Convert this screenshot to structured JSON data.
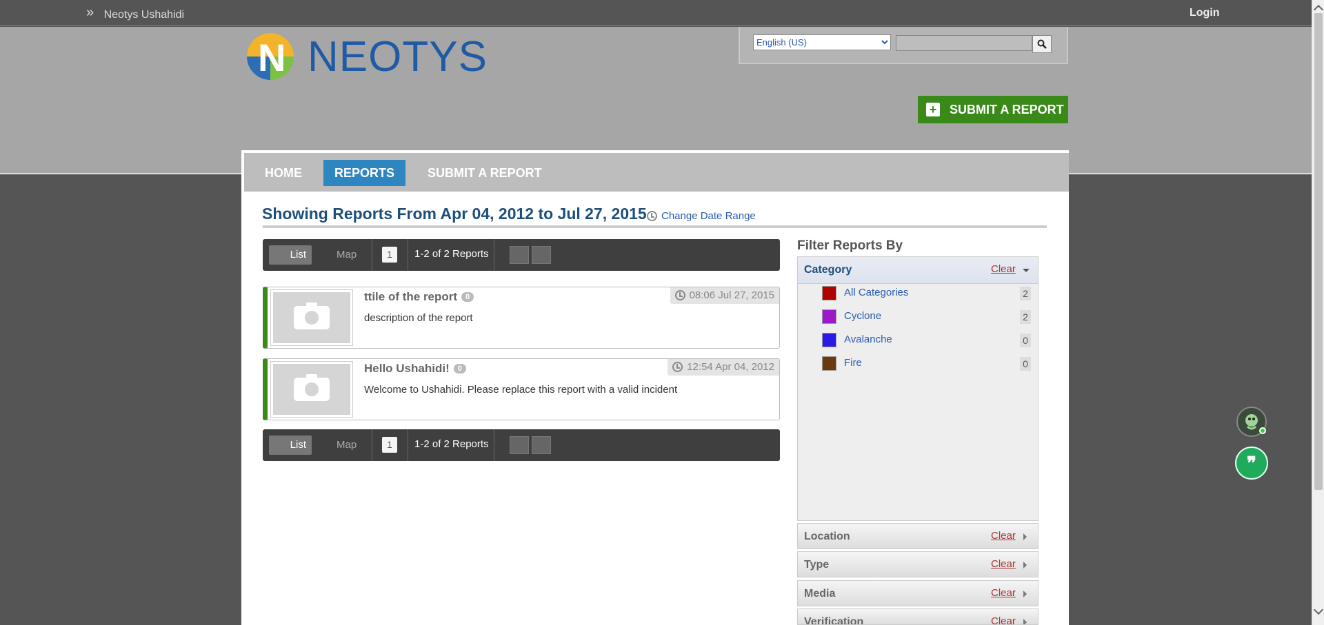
{
  "topbar": {
    "breadcrumb": "Neotys Ushahidi",
    "login_label": "Login"
  },
  "header": {
    "logo_text": "NEOTYS",
    "language_selected": "English (US)",
    "language_options": [
      "English (US)"
    ],
    "search_value": "",
    "submit_report_label": "SUBMIT A REPORT"
  },
  "nav": {
    "items": [
      {
        "label": "HOME",
        "active": false
      },
      {
        "label": "REPORTS",
        "active": true
      },
      {
        "label": "SUBMIT A REPORT",
        "active": false
      }
    ]
  },
  "main": {
    "heading": "Showing Reports From Apr 04, 2012 to Jul 27, 2015",
    "change_date_label": "Change Date Range",
    "pager": {
      "list_label": "List",
      "map_label": "Map",
      "page": "1",
      "count_text": "1-2 of 2 Reports"
    },
    "reports": [
      {
        "title": "ttile of the report",
        "comments": "0",
        "date": "08:06 Jul 27, 2015",
        "description": "description of the report"
      },
      {
        "title": "Hello Ushahidi!",
        "comments": "0",
        "date": "12:54 Apr 04, 2012",
        "description": "Welcome to Ushahidi. Please replace this report with a valid incident"
      }
    ]
  },
  "filters": {
    "title": "Filter Reports By",
    "clear_label": "Clear",
    "category_label": "Category",
    "categories": [
      {
        "name": "All Categories",
        "count": "2",
        "color": "#b00000"
      },
      {
        "name": "Cyclone",
        "count": "2",
        "color": "#9a19c9"
      },
      {
        "name": "Avalanche",
        "count": "0",
        "color": "#2a1ae6"
      },
      {
        "name": "Fire",
        "count": "0",
        "color": "#6a3a0c"
      }
    ],
    "sections": [
      "Location",
      "Type",
      "Media",
      "Verification"
    ]
  },
  "colors": {
    "accent_blue": "#2e86c1",
    "submit_green": "#3a8a1a"
  }
}
